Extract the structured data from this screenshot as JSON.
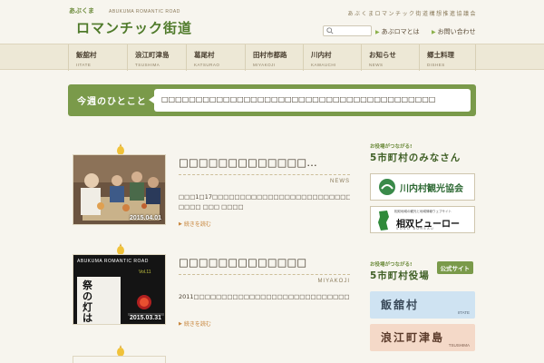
{
  "header": {
    "logo_small": "あぶくま",
    "logo_en": "ABUKUMA ROMANTIC ROAD",
    "logo_main": "ロマンチック街道",
    "tagline": "あぶくまロマンチック街道構想推進協議会",
    "search_placeholder": "",
    "link_about": "あぶロマとは",
    "link_contact": "お問い合わせ"
  },
  "nav": [
    {
      "jp": "飯舘村",
      "en": "IITATE"
    },
    {
      "jp": "浪江町津島",
      "en": "TSUSHIMA"
    },
    {
      "jp": "葛尾村",
      "en": "KATSURAO"
    },
    {
      "jp": "田村市都路",
      "en": "MIYAKOJI"
    },
    {
      "jp": "川内村",
      "en": "KAWAUCHI"
    },
    {
      "jp": "お知らせ",
      "en": "NEWS"
    },
    {
      "jp": "郷土料理",
      "en": "DISHES"
    }
  ],
  "weekly": {
    "label": "今週のひとこと",
    "text": "□□□□□□□□□□□□□□□□□□□□□□□□□□□□□□□□□□□□□□□□"
  },
  "posts": [
    {
      "title": "□□□□□□□□□□□□□…",
      "date": "2015.04.01",
      "category": "NEWS",
      "excerpt": "□□□1□17□□□□□□□□□□□□□□□□□□□□□□□□□□□□ □□□□ □□□ □□□□ 2□□□□□□□□□□□□□□□□□□□□ …",
      "more": "続きを読む"
    },
    {
      "title": "□□□□□□□□□□□□□",
      "date": "2015.03.31",
      "category": "MIYAKOJI",
      "excerpt": "2011□□□□□□□□□□□□□□□□□□□□□□□□□□□□□□□□□□□□□□□□□□□□□□□□□□□□□□□□□□□□□…",
      "more": "続きを読む",
      "thumb_text_en": "ABUKUMA ROMANTIC ROAD",
      "thumb_vol": "Vol.11",
      "thumb_jp": "祭の灯は"
    }
  ],
  "sidebar": {
    "sec1_small": "お役場がつながる!",
    "sec1_title": "5市町村のみなさん",
    "kawauchi_label": "川内村観光協会",
    "sodo_top": "相双地域の観光と地域情報ウェブサイト",
    "sodo_name": "相双ビューロー",
    "sodo_sub": "SOSO BUREAU",
    "sec2_small": "お役場がつながる!",
    "sec2_title": "5市町村役場",
    "sec2_badge": "公式サイト",
    "villages": [
      {
        "jp": "飯舘村",
        "en": "IITATE",
        "color": "#cfe3f2"
      },
      {
        "jp": "浪江町津島",
        "en": "TSUSHIMA",
        "color": "#f4d9c8"
      }
    ]
  },
  "colors": {
    "accent_green": "#7a9a4a",
    "background": "#f7f5ee",
    "more_link": "#c7843a"
  }
}
